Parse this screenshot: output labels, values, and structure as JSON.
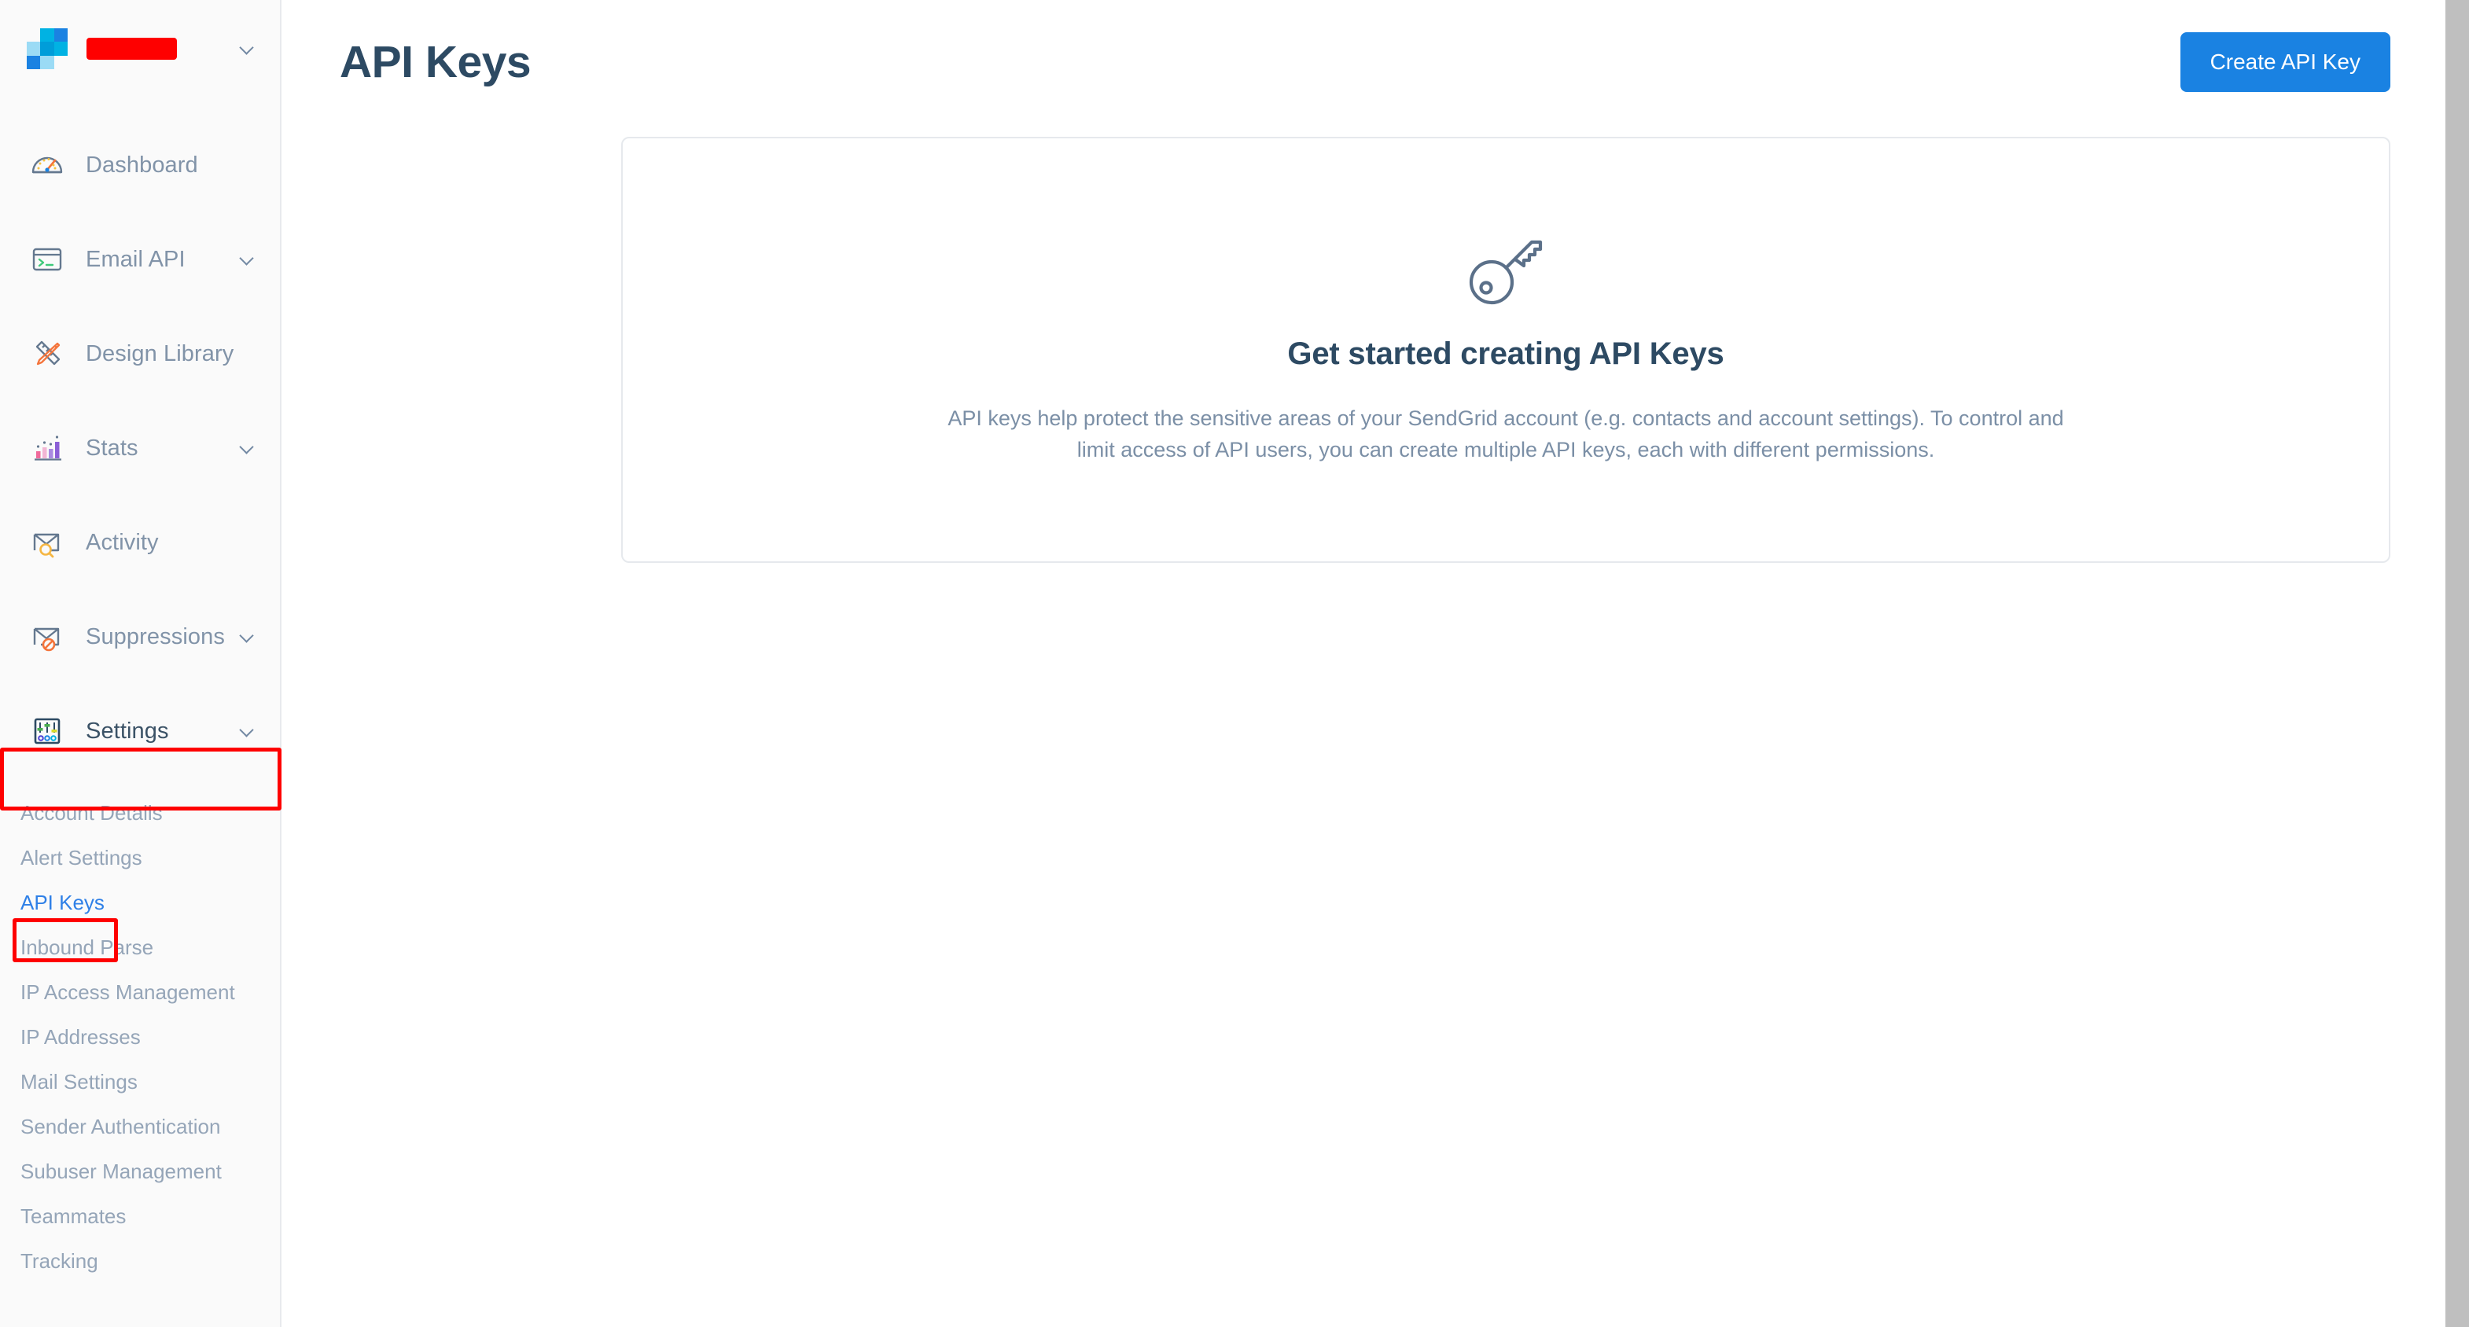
{
  "brand": {
    "logo_icon": "sendgrid-logo-icon",
    "account_name": "",
    "account_redacted": true,
    "caret_icon": "chevron-down-icon"
  },
  "sidebar": {
    "items": [
      {
        "label": "Dashboard",
        "icon": "speedometer-icon",
        "has_caret": false
      },
      {
        "label": "Email API",
        "icon": "terminal-window-icon",
        "has_caret": true
      },
      {
        "label": "Design Library",
        "icon": "ruler-pencil-icon",
        "has_caret": false
      },
      {
        "label": "Stats",
        "icon": "bar-chart-icon",
        "has_caret": true
      },
      {
        "label": "Activity",
        "icon": "envelope-search-icon",
        "has_caret": false
      },
      {
        "label": "Suppressions",
        "icon": "envelope-blocked-icon",
        "has_caret": true
      },
      {
        "label": "Settings",
        "icon": "sliders-icon",
        "has_caret": true
      }
    ],
    "settings_subitems": [
      {
        "label": "Account Details",
        "active": false
      },
      {
        "label": "Alert Settings",
        "active": false
      },
      {
        "label": "API Keys",
        "active": true
      },
      {
        "label": "Inbound Parse",
        "active": false
      },
      {
        "label": "IP Access Management",
        "active": false
      },
      {
        "label": "IP Addresses",
        "active": false
      },
      {
        "label": "Mail Settings",
        "active": false
      },
      {
        "label": "Sender Authentication",
        "active": false
      },
      {
        "label": "Subuser Management",
        "active": false
      },
      {
        "label": "Teammates",
        "active": false
      },
      {
        "label": "Tracking",
        "active": false
      }
    ]
  },
  "header": {
    "title": "API Keys",
    "create_button_label": "Create API Key"
  },
  "empty_state": {
    "icon": "key-icon",
    "title": "Get started creating API Keys",
    "description": "API keys help protect the sensitive areas of your SendGrid account (e.g. contacts and account settings). To control and limit access of API users, you can create multiple API keys, each with different permissions."
  },
  "annotations": [
    {
      "name": "settings-highlight",
      "target": "Settings"
    },
    {
      "name": "api-keys-highlight",
      "target": "API Keys"
    }
  ],
  "colors": {
    "accent_blue": "#1A82E2",
    "link_blue": "#2f80e7",
    "title_navy": "#2d4a63",
    "muted_text": "#8193a8",
    "annotation_red": "#FE0000",
    "sidebar_bg": "#fafafa",
    "card_border": "#e6e9ed"
  }
}
